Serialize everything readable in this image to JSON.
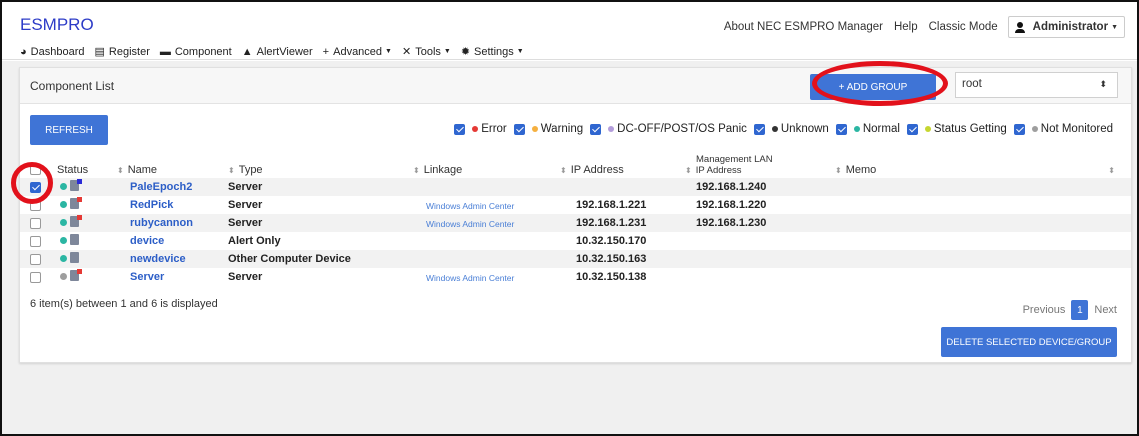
{
  "app": {
    "brand": "ESMPRO"
  },
  "top_links": {
    "about": "About NEC ESMPRO Manager",
    "help": "Help",
    "classic": "Classic Mode",
    "user": "Administrator"
  },
  "nav": {
    "dashboard": "Dashboard",
    "register": "Register",
    "component": "Component",
    "alertviewer": "AlertViewer",
    "advanced": "Advanced",
    "tools": "Tools",
    "settings": "Settings"
  },
  "panel": {
    "title": "Component List",
    "add_group": "+ ADD GROUP",
    "group_select": "root",
    "refresh": "REFRESH"
  },
  "legend": [
    {
      "label": "Error",
      "color": "#e53935",
      "checked": true
    },
    {
      "label": "Warning",
      "color": "#f5b040",
      "checked": true
    },
    {
      "label": "DC-OFF/POST/OS Panic",
      "color": "#b39ddb",
      "checked": true
    },
    {
      "label": "Unknown",
      "color": "#333333",
      "checked": true
    },
    {
      "label": "Normal",
      "color": "#2bb6a3",
      "checked": true
    },
    {
      "label": "Status Getting",
      "color": "#c6d630",
      "checked": true
    },
    {
      "label": "Not Monitored",
      "color": "#9e9e9e",
      "checked": true
    }
  ],
  "table": {
    "headers": {
      "status": "Status",
      "name": "Name",
      "type": "Type",
      "linkage": "Linkage",
      "ip": "IP Address",
      "mgmt_line1": "Management LAN",
      "mgmt_line2": "IP Address",
      "memo": "Memo"
    },
    "rows": [
      {
        "checked": true,
        "status_color": "#2bb6a3",
        "name": "PaleEpoch2",
        "type": "Server",
        "linkage": "",
        "ip": "",
        "mgmt_ip": "192.168.1.240",
        "memo": ""
      },
      {
        "checked": false,
        "status_color": "#2bb6a3",
        "name": "RedPick",
        "type": "Server",
        "linkage": "Windows Admin Center",
        "ip": "192.168.1.221",
        "mgmt_ip": "192.168.1.220",
        "memo": ""
      },
      {
        "checked": false,
        "status_color": "#2bb6a3",
        "name": "rubycannon",
        "type": "Server",
        "linkage": "Windows Admin Center",
        "ip": "192.168.1.231",
        "mgmt_ip": "192.168.1.230",
        "memo": ""
      },
      {
        "checked": false,
        "status_color": "#2bb6a3",
        "name": "device",
        "type": "Alert Only",
        "linkage": "",
        "ip": "10.32.150.170",
        "mgmt_ip": "",
        "memo": ""
      },
      {
        "checked": false,
        "status_color": "#2bb6a3",
        "name": "newdevice",
        "type": "Other Computer Device",
        "linkage": "",
        "ip": "10.32.150.163",
        "mgmt_ip": "",
        "memo": ""
      },
      {
        "checked": false,
        "status_color": "#9e9e9e",
        "name": "Server",
        "type": "Server",
        "linkage": "Windows Admin Center",
        "ip": "10.32.150.138",
        "mgmt_ip": "",
        "memo": ""
      }
    ]
  },
  "footer": {
    "info": "6 item(s) between 1 and 6 is displayed",
    "previous": "Previous",
    "page": "1",
    "next": "Next",
    "delete": "DELETE SELECTED DEVICE/GROUP"
  }
}
